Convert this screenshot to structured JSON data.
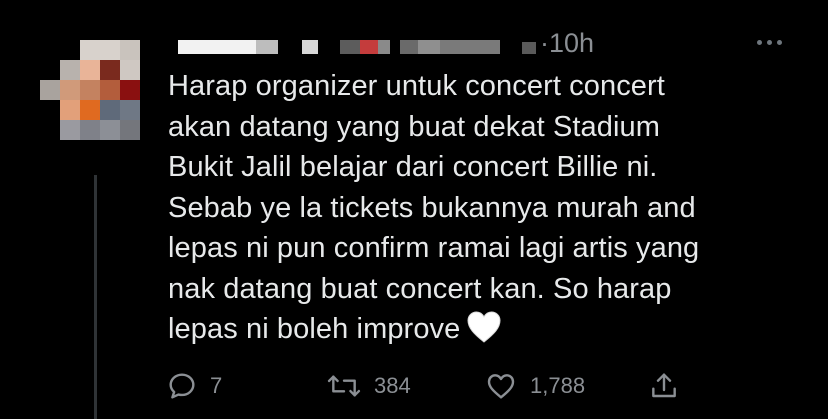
{
  "tweet": {
    "timestamp": "·10h",
    "text_lines": [
      "Harap organizer untuk concert concert",
      "akan datang yang buat dekat Stadium",
      "Bukit Jalil belajar dari concert Billie ni.",
      "Sebab ye la tickets bukannya murah and",
      "lepas ni pun confirm ramai lagi artis yang",
      "nak datang buat concert kan. So harap",
      "lepas ni boleh improve"
    ],
    "emoji": "white-heart"
  },
  "actions": {
    "reply_count": "7",
    "retweet_count": "384",
    "like_count": "1,788"
  },
  "icons": {
    "reply": "reply-icon",
    "retweet": "retweet-icon",
    "like": "like-icon",
    "share": "share-icon",
    "more": "more-icon"
  },
  "colors": {
    "background": "#000000",
    "text": "#e7e9ea",
    "secondary": "#8b8f94"
  }
}
